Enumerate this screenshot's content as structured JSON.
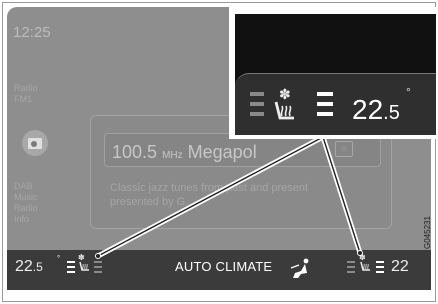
{
  "screen": {
    "clock": "12:25",
    "source_items": [
      "Radio",
      "FM1"
    ],
    "now_playing": {
      "frequency": "100.5",
      "unit": "MHz",
      "station": "Megapol",
      "description": "Classic jazz tunes from past and present presented by G..."
    },
    "side_labels": [
      "DAB",
      "Music",
      "Radio",
      "Info"
    ]
  },
  "climate_bar": {
    "driver_temp": "22.5",
    "driver_temp_whole": "22",
    "driver_temp_dec": ".5",
    "degree": "°",
    "label": "AUTO CLIMATE",
    "passenger_temp_partial": "22"
  },
  "callout": {
    "temp_whole": "22",
    "temp_dec": ".5",
    "degree": "°"
  },
  "figure_code": "G045231"
}
